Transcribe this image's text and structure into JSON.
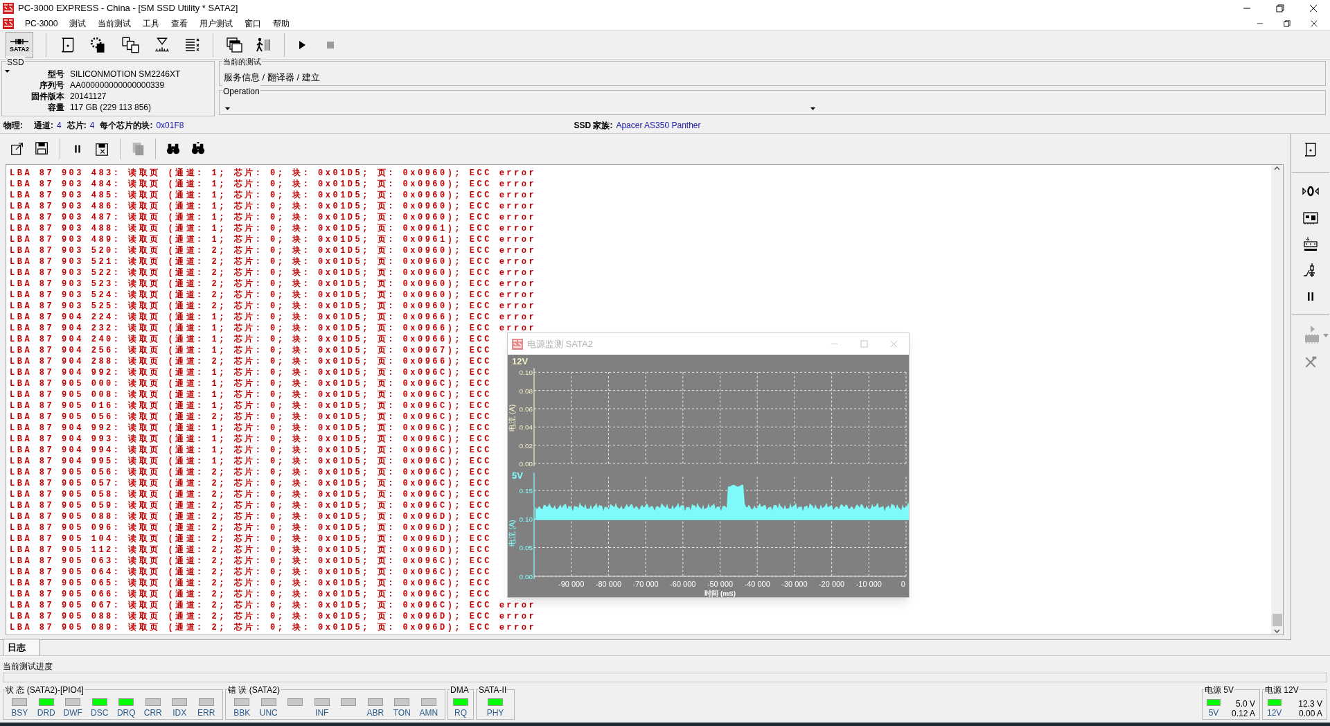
{
  "window": {
    "title": "PC-3000 EXPRESS - China - [SM SSD Utility * SATA2]"
  },
  "menu": [
    "PC-3000",
    "测试",
    "当前测试",
    "工具",
    "查看",
    "用户测试",
    "窗口",
    "帮助"
  ],
  "toolbar": {
    "port_button": "SATA2"
  },
  "ssd": {
    "title": "SSD",
    "fields": [
      {
        "label": "型号",
        "value": "SILICONMOTION SM2246XT"
      },
      {
        "label": "序列号",
        "value": "AA000000000000000339"
      },
      {
        "label": "固件版本",
        "value": "20141127"
      },
      {
        "label": "容量",
        "value": "117 GB (229 113 856)"
      }
    ]
  },
  "current_test": {
    "title": "当前的测试",
    "path": "服务信息 / 翻译器 / 建立"
  },
  "operation": {
    "title": "Operation"
  },
  "physical": {
    "label": "物理:",
    "items": [
      {
        "label": "通道:",
        "value": "4"
      },
      {
        "label": "芯片:",
        "value": "4"
      },
      {
        "label": "每个芯片的块:",
        "value": "0x01F8"
      }
    ]
  },
  "family": {
    "label": "SSD 家族:",
    "value": "Apacer AS350 Panther"
  },
  "log": {
    "lines": [
      "LBA 87 903 483: 读取页 (通道: 1; 芯片: 0; 块: 0x01D5; 页: 0x0960); ECC error",
      "LBA 87 903 484: 读取页 (通道: 1; 芯片: 0; 块: 0x01D5; 页: 0x0960); ECC error",
      "LBA 87 903 485: 读取页 (通道: 1; 芯片: 0; 块: 0x01D5; 页: 0x0960); ECC error",
      "LBA 87 903 486: 读取页 (通道: 1; 芯片: 0; 块: 0x01D5; 页: 0x0960); ECC error",
      "LBA 87 903 487: 读取页 (通道: 1; 芯片: 0; 块: 0x01D5; 页: 0x0960); ECC error",
      "LBA 87 903 488: 读取页 (通道: 1; 芯片: 0; 块: 0x01D5; 页: 0x0961); ECC error",
      "LBA 87 903 489: 读取页 (通道: 1; 芯片: 0; 块: 0x01D5; 页: 0x0961); ECC error",
      "LBA 87 903 520: 读取页 (通道: 2; 芯片: 0; 块: 0x01D5; 页: 0x0960); ECC error",
      "LBA 87 903 521: 读取页 (通道: 2; 芯片: 0; 块: 0x01D5; 页: 0x0960); ECC error",
      "LBA 87 903 522: 读取页 (通道: 2; 芯片: 0; 块: 0x01D5; 页: 0x0960); ECC error",
      "LBA 87 903 523: 读取页 (通道: 2; 芯片: 0; 块: 0x01D5; 页: 0x0960); ECC error",
      "LBA 87 903 524: 读取页 (通道: 2; 芯片: 0; 块: 0x01D5; 页: 0x0960); ECC error",
      "LBA 87 903 525: 读取页 (通道: 2; 芯片: 0; 块: 0x01D5; 页: 0x0960); ECC error",
      "LBA 87 904 224: 读取页 (通道: 1; 芯片: 0; 块: 0x01D5; 页: 0x0966); ECC error",
      "LBA 87 904 232: 读取页 (通道: 1; 芯片: 0; 块: 0x01D5; 页: 0x0966); ECC error",
      "LBA 87 904 240: 读取页 (通道: 1; 芯片: 0; 块: 0x01D5; 页: 0x0966); ECC",
      "LBA 87 904 256: 读取页 (通道: 1; 芯片: 0; 块: 0x01D5; 页: 0x0967); ECC",
      "LBA 87 904 288: 读取页 (通道: 2; 芯片: 0; 块: 0x01D5; 页: 0x0966); ECC",
      "LBA 87 904 992: 读取页 (通道: 1; 芯片: 0; 块: 0x01D5; 页: 0x096C); ECC",
      "LBA 87 905 000: 读取页 (通道: 1; 芯片: 0; 块: 0x01D5; 页: 0x096C); ECC",
      "LBA 87 905 008: 读取页 (通道: 1; 芯片: 0; 块: 0x01D5; 页: 0x096C); ECC",
      "LBA 87 905 016: 读取页 (通道: 1; 芯片: 0; 块: 0x01D5; 页: 0x096C); ECC",
      "LBA 87 905 056: 读取页 (通道: 2; 芯片: 0; 块: 0x01D5; 页: 0x096C); ECC",
      "LBA 87 904 992: 读取页 (通道: 1; 芯片: 0; 块: 0x01D5; 页: 0x096C); ECC",
      "LBA 87 904 993: 读取页 (通道: 1; 芯片: 0; 块: 0x01D5; 页: 0x096C); ECC",
      "LBA 87 904 994: 读取页 (通道: 1; 芯片: 0; 块: 0x01D5; 页: 0x096C); ECC",
      "LBA 87 904 995: 读取页 (通道: 1; 芯片: 0; 块: 0x01D5; 页: 0x096C); ECC",
      "LBA 87 905 056: 读取页 (通道: 2; 芯片: 0; 块: 0x01D5; 页: 0x096C); ECC",
      "LBA 87 905 057: 读取页 (通道: 2; 芯片: 0; 块: 0x01D5; 页: 0x096C); ECC",
      "LBA 87 905 058: 读取页 (通道: 2; 芯片: 0; 块: 0x01D5; 页: 0x096C); ECC",
      "LBA 87 905 059: 读取页 (通道: 2; 芯片: 0; 块: 0x01D5; 页: 0x096C); ECC",
      "LBA 87 905 088: 读取页 (通道: 2; 芯片: 0; 块: 0x01D5; 页: 0x096D); ECC",
      "LBA 87 905 096: 读取页 (通道: 2; 芯片: 0; 块: 0x01D5; 页: 0x096D); ECC",
      "LBA 87 905 104: 读取页 (通道: 2; 芯片: 0; 块: 0x01D5; 页: 0x096D); ECC",
      "LBA 87 905 112: 读取页 (通道: 2; 芯片: 0; 块: 0x01D5; 页: 0x096D); ECC",
      "LBA 87 905 063: 读取页 (通道: 2; 芯片: 0; 块: 0x01D5; 页: 0x096C); ECC",
      "LBA 87 905 064: 读取页 (通道: 2; 芯片: 0; 块: 0x01D5; 页: 0x096C); ECC",
      "LBA 87 905 065: 读取页 (通道: 2; 芯片: 0; 块: 0x01D5; 页: 0x096C); ECC",
      "LBA 87 905 066: 读取页 (通道: 2; 芯片: 0; 块: 0x01D5; 页: 0x096C); ECC",
      "LBA 87 905 067: 读取页 (通道: 2; 芯片: 0; 块: 0x01D5; 页: 0x096C); ECC error",
      "LBA 87 905 088: 读取页 (通道: 2; 芯片: 0; 块: 0x01D5; 页: 0x096D); ECC error",
      "LBA 87 905 089: 读取页 (通道: 2; 芯片: 0; 块: 0x01D5; 页: 0x096D); ECC error"
    ]
  },
  "power_window": {
    "title": "电源监测 SATA2",
    "panels": [
      {
        "label": "12V",
        "ylabel": "电流 (A)",
        "yticks": [
          "0.10",
          "0.08",
          "0.06",
          "0.04",
          "0.02",
          "0.00"
        ]
      },
      {
        "label": "5V",
        "ylabel": "电流 (A)",
        "yticks": [
          "0.15",
          "0.10",
          "0.05",
          "0.00"
        ]
      }
    ],
    "xticks": [
      "-90 000",
      "-80 000",
      "-70 000",
      "-60 000",
      "-50 000",
      "-40 000",
      "-30 000",
      "-20 000",
      "-10 000",
      "0"
    ],
    "xlabel": "时间 (mS)"
  },
  "tabs": [
    {
      "label": "日志",
      "selected": true
    }
  ],
  "progress": {
    "label": "当前测试进度",
    "level": 0
  },
  "status_groups": [
    {
      "title": "状 态 (SATA2)-[PIO4]",
      "leds": [
        {
          "label": "BSY",
          "on": false
        },
        {
          "label": "DRD",
          "on": true
        },
        {
          "label": "DWF",
          "on": false
        },
        {
          "label": "DSC",
          "on": true
        },
        {
          "label": "DRQ",
          "on": true
        },
        {
          "label": "CRR",
          "on": false
        },
        {
          "label": "IDX",
          "on": false
        },
        {
          "label": "ERR",
          "on": false
        }
      ]
    },
    {
      "title": "错 误 (SATA2)",
      "leds": [
        {
          "label": "BBK",
          "on": false
        },
        {
          "label": "UNC",
          "on": false
        },
        {
          "on": false
        },
        {
          "label": "INF",
          "on": false
        },
        {
          "on": false
        },
        {
          "label": "ABR",
          "on": false
        },
        {
          "label": "TON",
          "on": false
        },
        {
          "label": "AMN",
          "on": false
        }
      ]
    },
    {
      "title": "DMA",
      "leds": [
        {
          "label": "RQ",
          "on": true
        }
      ]
    },
    {
      "title": "SATA-II",
      "leds": [
        {
          "label": "PHY",
          "on": true
        }
      ]
    }
  ],
  "power": [
    {
      "title": "电源 5V",
      "led_label": "5V",
      "on": true,
      "voltage": "5.0 V",
      "current": "0.12 A"
    },
    {
      "title": "电源 12V",
      "led_label": "12V",
      "on": true,
      "voltage": "12.3 V",
      "current": "0.00 A"
    }
  ]
}
